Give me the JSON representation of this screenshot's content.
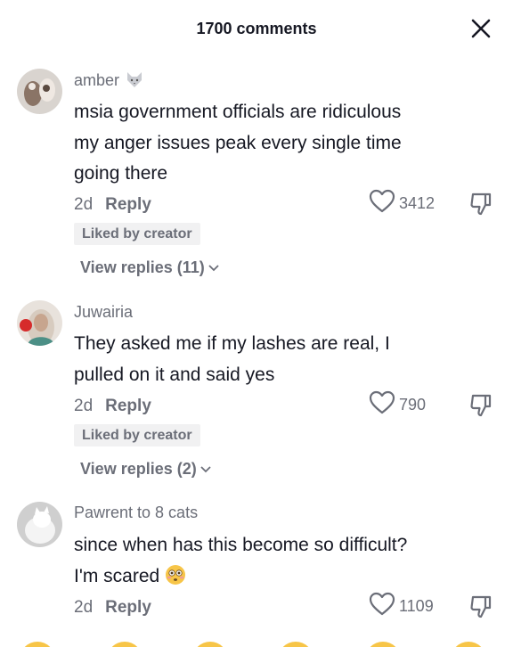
{
  "header": {
    "title": "1700 comments"
  },
  "comments": [
    {
      "username": "amber",
      "text_lines": [
        "msia government officials are ridiculous",
        "my anger issues peak every single time",
        "going there"
      ],
      "age": "2d",
      "reply_label": "Reply",
      "likes": "3412",
      "badge": "Liked by creator",
      "view_replies": "View replies (11)"
    },
    {
      "username": "Juwairia",
      "text_lines": [
        "They asked me if my lashes are real, I",
        "pulled on it and said yes"
      ],
      "age": "2d",
      "reply_label": "Reply",
      "likes": "790",
      "badge": "Liked by creator",
      "view_replies": "View replies (2)"
    },
    {
      "username": "Pawrent to 8 cats",
      "text_lines": [
        "since when has this become so difficult?",
        "I'm scared"
      ],
      "age": "2d",
      "reply_label": "Reply",
      "likes": "1109"
    }
  ],
  "icons": {
    "close": "close-icon",
    "like": "heart-outline-icon",
    "dislike": "thumbs-down-icon",
    "chevron": "chevron-down-icon",
    "wolf": "wolf-emoji-icon",
    "flushed": "flushed-face-emoji-icon"
  },
  "colors": {
    "text": "#161823",
    "secondary": "#6b6e78",
    "badge_bg": "#f1f1f2",
    "emoji": "#f7c548"
  }
}
